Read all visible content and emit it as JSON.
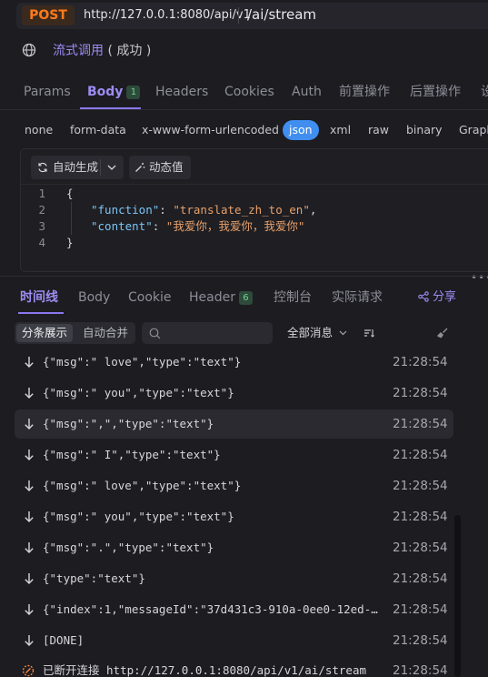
{
  "request": {
    "method": "POST",
    "url_base": "http://127.0.0.1:8080/api/v1",
    "path": "/ai/stream"
  },
  "doc": {
    "name": "流式调用",
    "status": "( 成功 )"
  },
  "tabs": {
    "params": "Params",
    "body": "Body",
    "body_count": "1",
    "headers": "Headers",
    "cookies": "Cookies",
    "auth": "Auth",
    "pre": "前置操作",
    "post": "后置操作",
    "overflow": "设"
  },
  "body_types": {
    "none": "none",
    "form_data": "form-data",
    "urlencoded": "x-www-form-urlencoded",
    "json": "json",
    "xml": "xml",
    "raw": "raw",
    "binary": "binary",
    "graphql": "Graph"
  },
  "editor": {
    "auto_generate": "自动生成",
    "dynamic_value": "动态值",
    "line_numbers": [
      "1",
      "2",
      "3",
      "4"
    ],
    "open_brace": "{",
    "close_brace": "}",
    "key_function": "\"function\"",
    "val_function": "\"translate_zh_to_en\"",
    "key_content": "\"content\"",
    "val_content": "\"我爱你，我爱你，我爱你\"",
    "colon": ": ",
    "comma": ","
  },
  "response_tabs": {
    "timeline": "时间线",
    "body": "Body",
    "cookie": "Cookie",
    "header": "Header",
    "header_count": "6",
    "console": "控制台",
    "actual": "实际请求",
    "share": "分享"
  },
  "filter": {
    "split": "分条展示",
    "merge": "自动合并",
    "all_messages": "全部消息"
  },
  "events": [
    {
      "msg": "{\"msg\":\" love\",\"type\":\"text\"}",
      "time": "21:28:54"
    },
    {
      "msg": "{\"msg\":\" you\",\"type\":\"text\"}",
      "time": "21:28:54"
    },
    {
      "msg": "{\"msg\":\",\",\"type\":\"text\"}",
      "time": "21:28:54"
    },
    {
      "msg": "{\"msg\":\" I\",\"type\":\"text\"}",
      "time": "21:28:54"
    },
    {
      "msg": "{\"msg\":\" love\",\"type\":\"text\"}",
      "time": "21:28:54"
    },
    {
      "msg": "{\"msg\":\" you\",\"type\":\"text\"}",
      "time": "21:28:54"
    },
    {
      "msg": "{\"msg\":\".\",\"type\":\"text\"}",
      "time": "21:28:54"
    },
    {
      "msg": "{\"type\":\"text\"}",
      "time": "21:28:54"
    },
    {
      "msg": "{\"index\":1,\"messageId\":\"37d431c3-910a-0ee0-12ed-97...",
      "time": "21:28:54"
    },
    {
      "msg": "[DONE]",
      "time": "21:28:54"
    }
  ],
  "disconnect": {
    "msg": "已断开连接 http://127.0.0.1:8080/api/v1/ai/stream",
    "time": "21:28:54"
  },
  "colors": {
    "accent": "#9d8cf2",
    "method": "#ff7a1a",
    "json_active": "#3f8ef0",
    "badge_green": "#6fd48c"
  }
}
